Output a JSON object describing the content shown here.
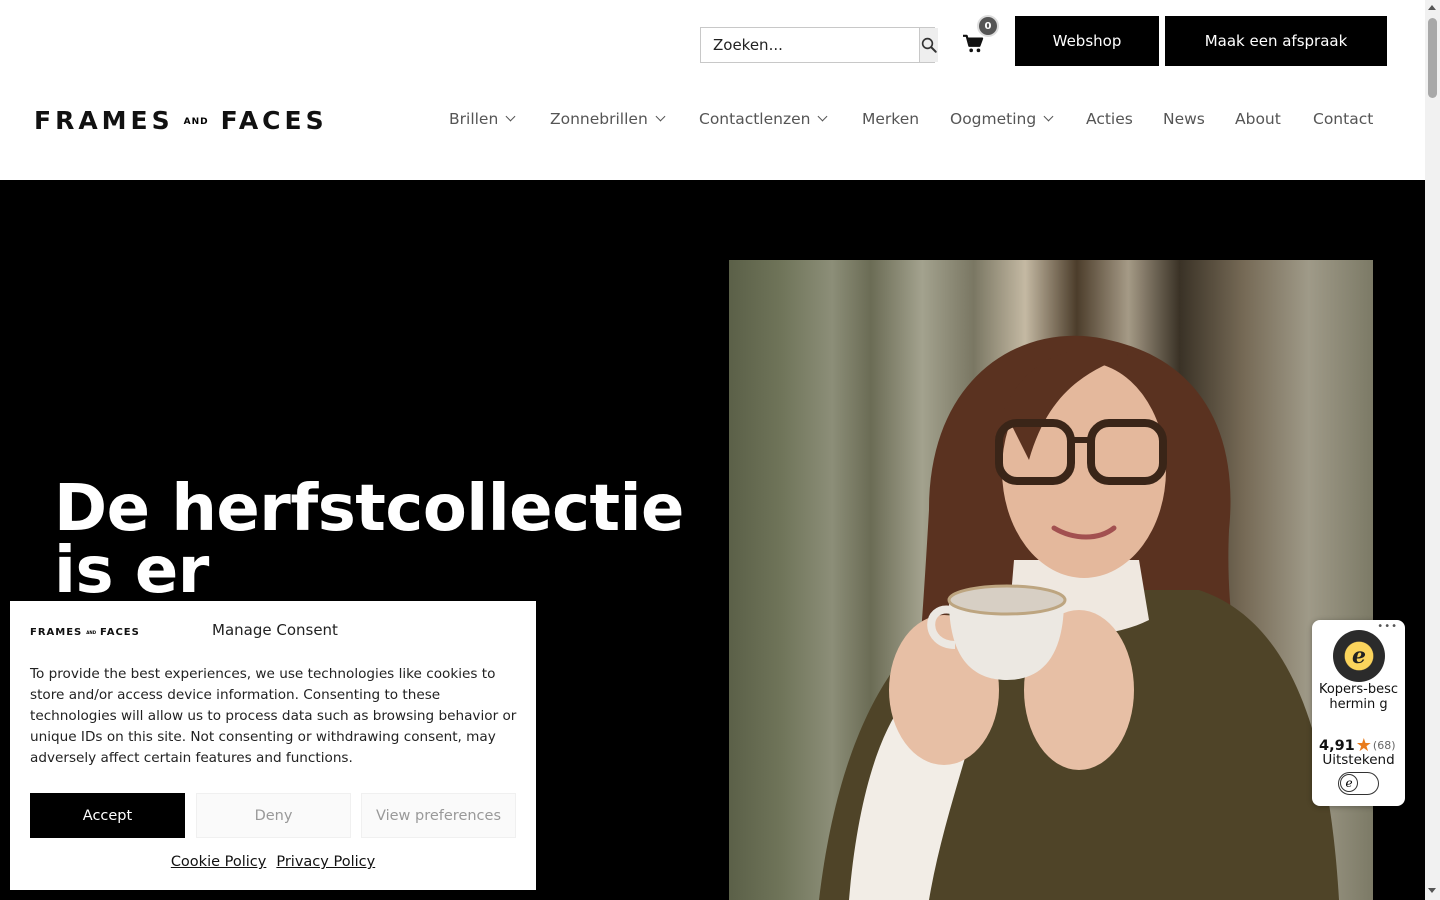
{
  "header": {
    "search": {
      "placeholder": "Zoeken..."
    },
    "cart": {
      "count": "0"
    },
    "buttons": {
      "webshop": "Webshop",
      "appointment": "Maak een afspraak"
    },
    "logo": {
      "left": "FRAMES",
      "and": "AND",
      "right": "FACES"
    }
  },
  "nav": {
    "items": [
      {
        "label": "Brillen",
        "dropdown": true
      },
      {
        "label": "Zonnebrillen",
        "dropdown": true
      },
      {
        "label": "Contactlenzen",
        "dropdown": true
      },
      {
        "label": "Merken",
        "dropdown": false
      },
      {
        "label": "Oogmeting",
        "dropdown": true
      },
      {
        "label": "Acties",
        "dropdown": false
      },
      {
        "label": "News",
        "dropdown": false
      },
      {
        "label": "About",
        "dropdown": false
      },
      {
        "label": "Contact",
        "dropdown": false
      }
    ]
  },
  "hero": {
    "title_line1": "De herfstcollectie",
    "title_line2": "is er"
  },
  "consent": {
    "title": "Manage Consent",
    "text": "To provide the best experiences, we use technologies like cookies to store and/or access device information. Consenting to these technologies will allow us to process data such as browsing behavior or unique IDs on this site. Not consenting or withdrawing consent, may adversely affect certain features and functions.",
    "accept": "Accept",
    "deny": "Deny",
    "preferences": "View preferences",
    "cookie_policy": "Cookie Policy",
    "privacy_policy": "Privacy Policy"
  },
  "trust_badge": {
    "seal_letter": "e",
    "label": "Kopers-beschermin g",
    "score": "4,91",
    "count": "(68)",
    "verdict": "Uitstekend"
  },
  "colors": {
    "black": "#000000",
    "white": "#ffffff",
    "nav_text": "#555555",
    "star": "#e97c1d"
  }
}
